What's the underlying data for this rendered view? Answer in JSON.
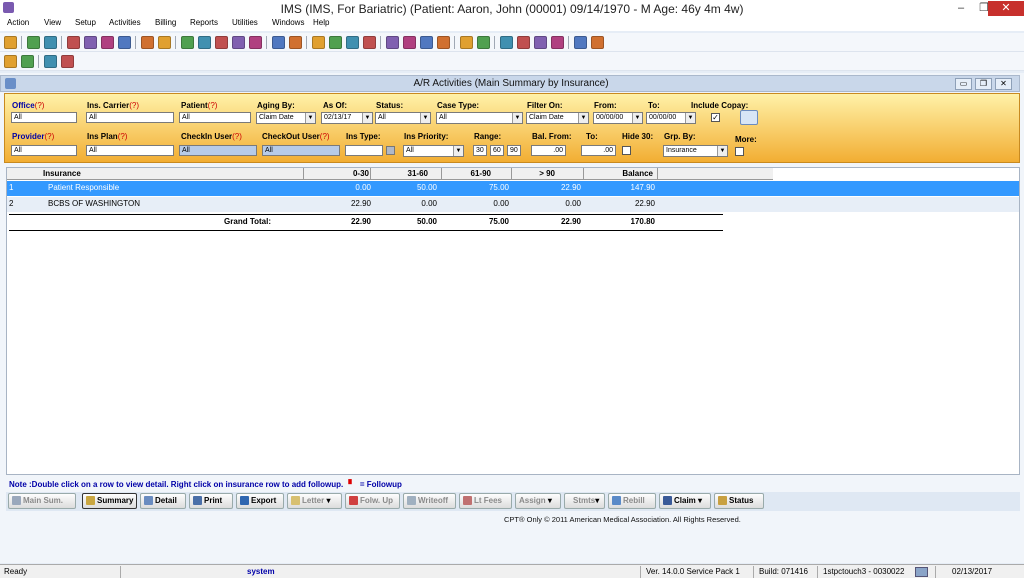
{
  "app": {
    "title": "IMS (IMS, For Bariatric)   (Patient: Aaron, John  (00001) 09/14/1970 - M Age: 46y 4m 4w)"
  },
  "menu": [
    "Action",
    "View",
    "Setup",
    "Activities",
    "Billing",
    "Reports",
    "Utilities",
    "Windows",
    "Help"
  ],
  "toolbar": {
    "row1_icons": [
      "user-icon",
      "user-edit-icon",
      "folder-icon",
      "calendar-icon",
      "chart-icon",
      "flask-icon",
      "shield-icon",
      "grid-icon",
      "notes-icon",
      "transfer-icon",
      "people-icon",
      "camera-icon",
      "people2-icon",
      "key-icon",
      "form-icon",
      "wizard-icon",
      "pills-icon",
      "back-icon",
      "disc-icon",
      "camera2-icon",
      "lab-icon",
      "lab2-icon",
      "doc-icon",
      "doc2-icon",
      "pages-icon",
      "reply-icon",
      "refresh-icon",
      "word-icon",
      "sheet-icon",
      "help-icon",
      "lock-icon",
      "exit-icon"
    ],
    "row2_icons": [
      "refresh-icon",
      "globe-icon",
      "help-icon",
      "cancel-icon"
    ]
  },
  "window": {
    "title": "A/R Activities  (Main Summary by Insurance)"
  },
  "filters": {
    "office": {
      "label": "Office",
      "q": "(?)",
      "value": "All"
    },
    "ins_carrier": {
      "label": "Ins. Carrier",
      "q": "(?)",
      "value": "All"
    },
    "patient": {
      "label": "Patient",
      "q": "(?)",
      "value": "All"
    },
    "aging_by": {
      "label": "Aging By:",
      "value": "Claim Date"
    },
    "as_of": {
      "label": "As Of:",
      "value": "02/13/17"
    },
    "status": {
      "label": "Status:",
      "value": "All"
    },
    "case_type": {
      "label": "Case Type:",
      "value": "All"
    },
    "filter_on": {
      "label": "Filter On:",
      "value": "Claim Date"
    },
    "from": {
      "label": "From:",
      "value": "00/00/00"
    },
    "to": {
      "label": "To:",
      "value": "00/00/00"
    },
    "include_copay": {
      "label": "Include Copay:",
      "checked": "✓"
    },
    "provider": {
      "label": "Provider",
      "q": "(?)",
      "value": "All"
    },
    "ins_plan": {
      "label": "Ins Plan",
      "q": "(?)",
      "value": "All"
    },
    "checkin_user": {
      "label": "CheckIn User",
      "q": "(?)",
      "value": "All"
    },
    "checkout_user": {
      "label": "CheckOut User",
      "q": "(?)",
      "value": "All"
    },
    "ins_type": {
      "label": "Ins Type:",
      "value": ""
    },
    "ins_priority": {
      "label": "Ins Priority:",
      "value": "All"
    },
    "range": {
      "label": "Range:",
      "v1": "30",
      "v2": "60",
      "v3": "90"
    },
    "bal_from": {
      "label": "Bal. From:",
      "value": ".00"
    },
    "bal_to": {
      "label": "To:",
      "value": ".00"
    },
    "hide30": {
      "label": "Hide 30:"
    },
    "grp_by": {
      "label": "Grp. By:",
      "value": "Insurance"
    },
    "more": {
      "label": "More:"
    }
  },
  "grid": {
    "headers": [
      "Insurance",
      "0-30",
      "31-60",
      "61-90",
      "> 90",
      "Balance"
    ],
    "rows": [
      {
        "num": "1",
        "ins": "Patient Responsible",
        "c1": "0.00",
        "c2": "50.00",
        "c3": "75.00",
        "c4": "22.90",
        "bal": "147.90"
      },
      {
        "num": "2",
        "ins": "BCBS OF WASHINGTON",
        "c1": "22.90",
        "c2": "0.00",
        "c3": "0.00",
        "c4": "0.00",
        "bal": "22.90"
      }
    ],
    "total": {
      "label": "Grand Total:",
      "c1": "22.90",
      "c2": "50.00",
      "c3": "75.00",
      "c4": "22.90",
      "bal": "170.80"
    }
  },
  "note": "Note :Double click on a row to view detail. Right click on insurance row to add followup.",
  "note_legend": "= Followup",
  "buttons": [
    "Main Sum.",
    "Summary",
    "Detail",
    "Print",
    "Export",
    "Letter",
    "Folw. Up",
    "Writeoff",
    "Lt Fees",
    "Assign",
    "Stmts",
    "Rebill",
    "Claim",
    "Status"
  ],
  "copyright": "CPT® Only © 2011 American Medical Association.  All Rights Reserved.",
  "status": {
    "ready": "Ready",
    "user": "system",
    "version": "Ver. 14.0.0 Service Pack 1",
    "build": "Build: 071416",
    "server": "1stpctouch3 - 0030022",
    "date": "02/13/2017"
  },
  "colors": {
    "accent": "#3399ff",
    "orange": "#f2ae33",
    "close": "#c7302c"
  }
}
